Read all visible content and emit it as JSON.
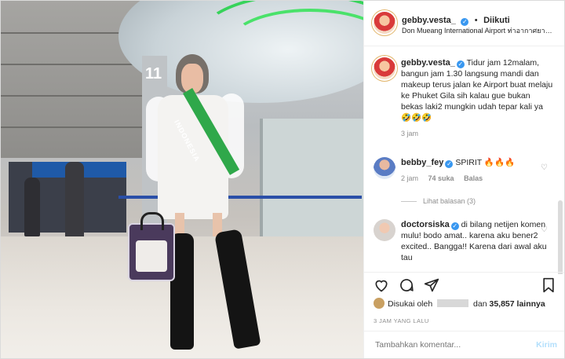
{
  "post": {
    "username": "gebby.vesta_",
    "follow_status": "Diikuti",
    "location": "Don Mueang International Airport ท่าอากาศยา…",
    "photo": {
      "pillar_number": "11",
      "sash_text": "INDONESIA"
    }
  },
  "caption": {
    "username": "gebby.vesta_",
    "text": "Tidur jam 12malam, bangun jam 1.30 langsung mandi dan makeup terus jalan ke Airport buat melaju ke Phuket Gila sih kalau gue bukan bekas laki2 mungkin udah tepar kali ya 🤣🤣🤣",
    "age": "3 jam"
  },
  "comments": [
    {
      "username": "bebby_fey",
      "text": "SPIRIT 🔥🔥🔥",
      "age": "2 jam",
      "likes": "74 suka",
      "reply_label": "Balas",
      "view_replies": "Lihat balasan (3)"
    },
    {
      "username": "doctorsiska",
      "text": "di bilang netijen komen mulu! bodo amat.. karena aku bener2 excited.. Bangga!! Karena dari awal aku tau"
    }
  ],
  "likes": {
    "prefix": "Disukai oleh",
    "middle": "dan",
    "count": "35,857 lainnya"
  },
  "timestamp": "3 JAM YANG LALU",
  "comment_box": {
    "placeholder": "Tambahkan komentar...",
    "post_label": "Kirim"
  },
  "colors": {
    "verified": "#3897f0",
    "post_disabled": "#b2dffc",
    "sash": "#2fa84a"
  },
  "icons": {
    "like": "heart-icon",
    "comment": "comment-icon",
    "share": "paper-plane-icon",
    "save": "bookmark-icon"
  }
}
